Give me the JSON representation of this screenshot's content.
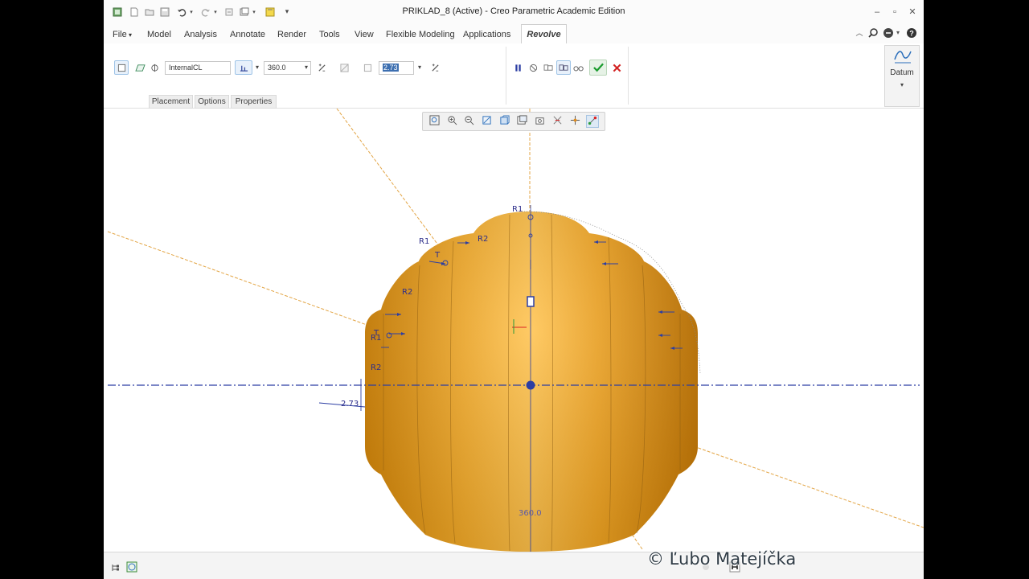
{
  "window": {
    "title": "PRIKLAD_8 (Active) - Creo Parametric Academic Edition"
  },
  "ribbon": {
    "tabs": [
      "File",
      "Model",
      "Analysis",
      "Annotate",
      "Render",
      "Tools",
      "View",
      "Flexible Modeling",
      "Applications"
    ],
    "active_tab": "Revolve"
  },
  "dashboard": {
    "axis_reference": "InternalCL",
    "angle_value": "360.0",
    "thickness_value": "2.73",
    "subtabs": [
      "Placement",
      "Options",
      "Properties"
    ],
    "datum_label": "Datum"
  },
  "icons": {
    "qat": [
      "app-icon",
      "new-icon",
      "open-icon",
      "save-icon",
      "undo-icon",
      "redo-icon",
      "regenerate-icon",
      "windows-icon",
      "close-window-icon",
      "customize-icon"
    ],
    "dashboard": [
      "solid-icon",
      "surface-icon",
      "revolve-icon",
      "angle-type-icon",
      "flip-angle-icon",
      "remove-material-icon",
      "thicken-icon",
      "flip-thickness-icon",
      "pause-icon",
      "no-preview-icon",
      "attached-preview-icon",
      "detached-preview-icon",
      "verify-icon",
      "ok-icon",
      "cancel-icon"
    ],
    "view": [
      "refit-icon",
      "zoom-in-icon",
      "zoom-out-icon",
      "repaint-icon",
      "display-style-icon",
      "saved-views-icon",
      "view-manager-icon",
      "datum-display-icon",
      "spin-center-icon",
      "annotation-display-icon"
    ]
  },
  "model": {
    "dimension_labels": [
      "R1",
      "R2",
      "R1",
      "R2",
      "R1",
      "R2"
    ],
    "thickness_dim": "2.73",
    "angle_dim": "360.0",
    "color": "#f0a020"
  },
  "watermark": "© Ľubo Matejíčka",
  "colors": {
    "accent": "#2a6ebb",
    "ok_green": "#1a9b2e",
    "cancel_red": "#d21f1f",
    "model_orange": "#f0a020",
    "sketch_blue": "#2c2d8a"
  }
}
